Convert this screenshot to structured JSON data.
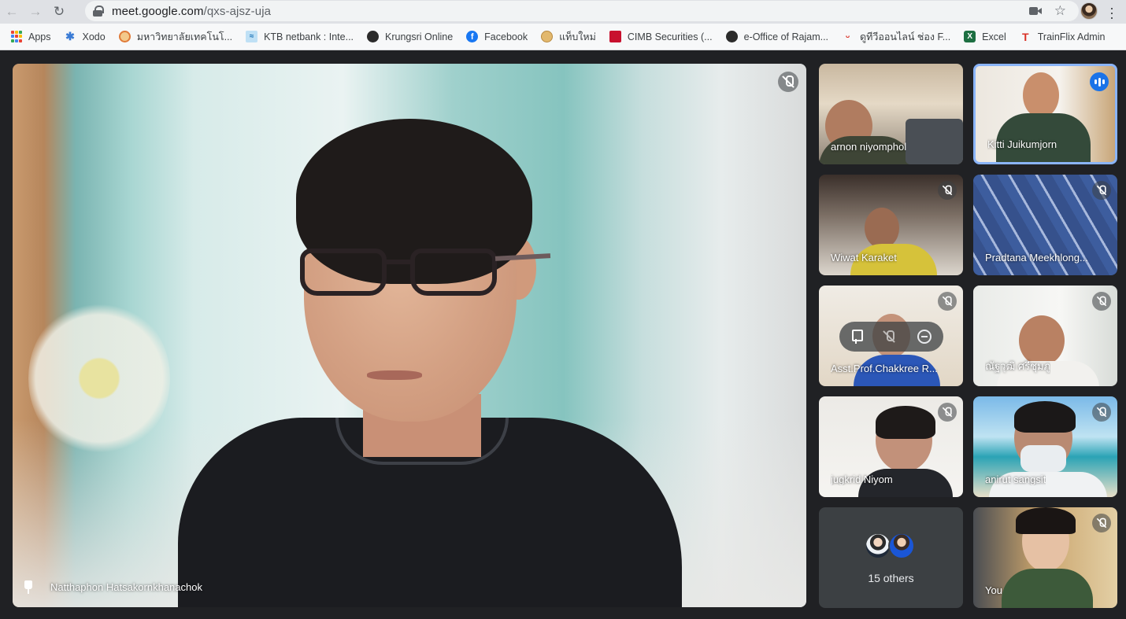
{
  "browser": {
    "url_host": "meet.google.com",
    "url_path": "/qxs-ajsz-uja",
    "bookmarks": [
      {
        "label": "Apps",
        "icon": "apps-grid-icon"
      },
      {
        "label": "Xodo",
        "icon": "xodo-icon"
      },
      {
        "label": "มหาวิทยาลัยเทคโนโ...",
        "icon": "university-icon"
      },
      {
        "label": "KTB netbank : Inte...",
        "icon": "ktb-icon"
      },
      {
        "label": "Krungsri Online",
        "icon": "globe-icon"
      },
      {
        "label": "Facebook",
        "icon": "facebook-icon"
      },
      {
        "label": "แท็บใหม่",
        "icon": "cookie-icon"
      },
      {
        "label": "CIMB Securities (...",
        "icon": "cimb-icon"
      },
      {
        "label": "e-Office of Rajam...",
        "icon": "globe-icon"
      },
      {
        "label": "ดูทีวีออนไลน์ ช่อง F...",
        "icon": "tv-icon"
      },
      {
        "label": "Excel",
        "icon": "excel-icon"
      },
      {
        "label": "TrainFlix Admin",
        "icon": "trainflix-icon"
      }
    ]
  },
  "meeting": {
    "main_speaker": {
      "name": "Natthaphon Hatsakornkhanachok",
      "muted": true,
      "pinned": true
    },
    "participants": [
      {
        "name": "arnon niyomphol",
        "muted": false
      },
      {
        "name": "Kitti Juikumjorn",
        "muted": false,
        "speaking": true
      },
      {
        "name": "Wiwat Karaket",
        "muted": true
      },
      {
        "name": "Pradtana Meekhlong...",
        "muted": true
      },
      {
        "name": "Asst.Prof.Chakkree R...",
        "muted": true
      },
      {
        "name": "ณัฐวุฒิ ศรีชุมภู",
        "muted": true
      },
      {
        "name": "jugkrid Niyom",
        "muted": true
      },
      {
        "name": "anirut sangsit",
        "muted": true
      }
    ],
    "others_label": "15 others",
    "self_label": "You"
  },
  "colors": {
    "accent": "#1a73e8",
    "active_border": "#8ab4f8",
    "background": "#202124"
  }
}
